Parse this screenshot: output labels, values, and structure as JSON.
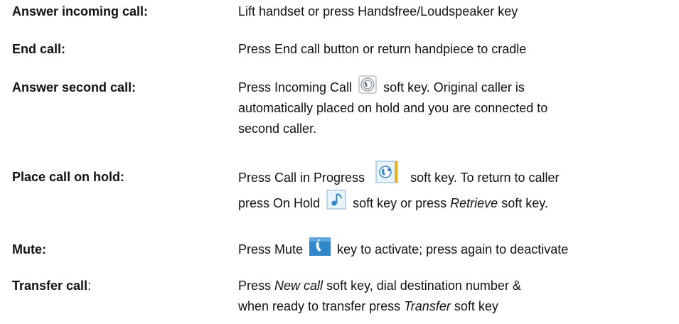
{
  "entries": [
    {
      "term": "Answer incoming call:",
      "desc": "Lift handset or press Handsfree/Loudspeaker key"
    },
    {
      "term": "End call:",
      "desc": "Press End call button or return handpiece to cradle"
    },
    {
      "term": "Answer second call:",
      "desc_a": "Press Incoming Call",
      "desc_b": "soft key. Original caller is",
      "desc_line2": "automatically placed on hold and you are connected to",
      "desc_line3": "second caller.",
      "icon": "incoming-call-icon"
    },
    {
      "term": "Place call on hold:",
      "desc_a": "Press Call in Progress",
      "desc_b": "soft key.  To return to caller",
      "desc_line2_a": "press On Hold",
      "desc_line2_b": "soft key or press",
      "desc_line2_italic": "Retrieve",
      "desc_line2_c": "soft key.",
      "icon": "call-in-progress-icon",
      "icon2": "on-hold-icon"
    },
    {
      "term": "Mute:",
      "desc_a": "Press Mute",
      "desc_b": "key to activate; press again to deactivate",
      "icon": "mute-icon"
    },
    {
      "term_bold": "Transfer call",
      "term_colon": ":",
      "desc_a": "Press",
      "desc_italic1": "New call",
      "desc_b": "soft key, dial destination number &",
      "desc_line2_a": "when ready to transfer press",
      "desc_line2_italic": "Transfer",
      "desc_line2_b": "soft key"
    }
  ],
  "colors": {
    "text": "#111111",
    "icon_blue": "#2f86c8",
    "icon_light_blue": "#cfe6f7",
    "icon_gold": "#e4b52a"
  }
}
